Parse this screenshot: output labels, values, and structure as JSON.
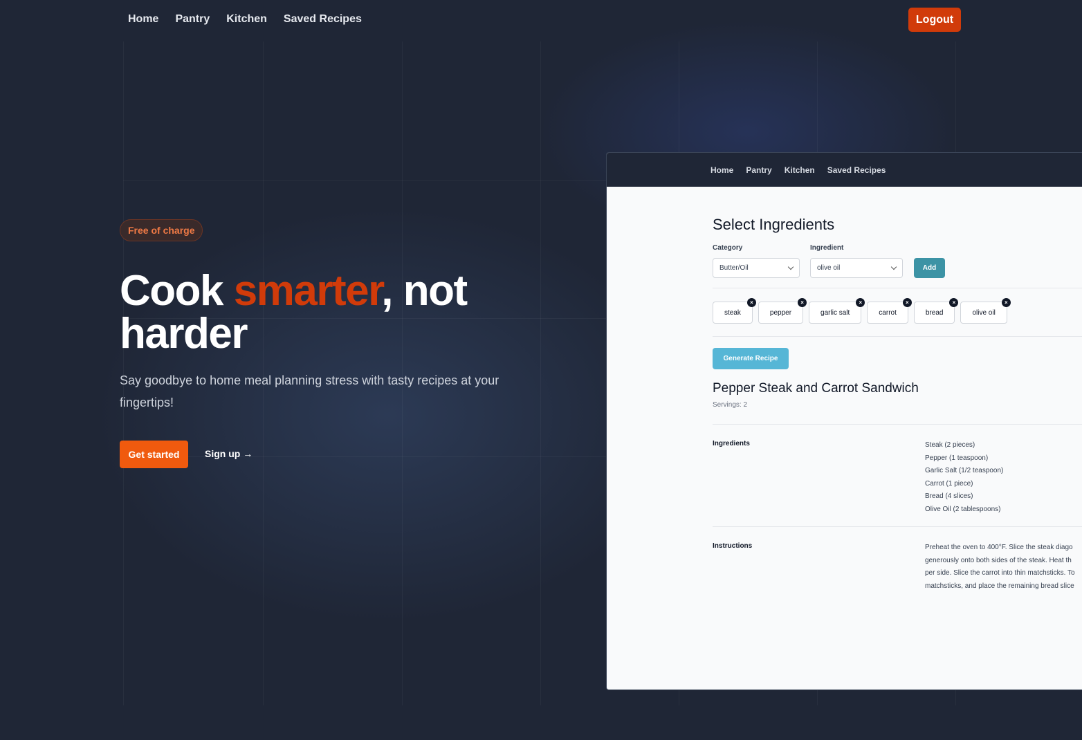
{
  "nav": {
    "links": [
      "Home",
      "Pantry",
      "Kitchen",
      "Saved Recipes"
    ],
    "logout_label": "Logout"
  },
  "hero": {
    "badge": "Free of charge",
    "headline_part1": "Cook ",
    "headline_accent": "smarter",
    "headline_part2": ", not harder",
    "subtext": "Say goodbye to home meal planning stress with tasty recipes at your fingertips!",
    "cta_label": "Get started",
    "signup_label": "Sign up →"
  },
  "preview": {
    "nav_links": [
      "Home",
      "Pantry",
      "Kitchen",
      "Saved Recipes"
    ],
    "title": "Select Ingredients",
    "category_label": "Category",
    "category_value": "Butter/Oil",
    "ingredient_label": "Ingredient",
    "ingredient_value": "olive oil",
    "add_label": "Add",
    "selected_ingredients": [
      "steak",
      "pepper",
      "garlic salt",
      "carrot",
      "bread",
      "olive oil"
    ],
    "remove_icon": "×",
    "generate_label": "Generate Recipe",
    "recipe_title": "Pepper Steak and Carrot Sandwich",
    "servings": "Servings: 2",
    "ingredients_label": "Ingredients",
    "ingredients": [
      "Steak (2 pieces)",
      "Pepper (1 teaspoon)",
      "Garlic Salt (1/2 teaspoon)",
      "Carrot (1 piece)",
      "Bread (4 slices)",
      "Olive Oil (2 tablespoons)"
    ],
    "instructions_label": "Instructions",
    "instructions_lines": [
      "Preheat the oven to 400°F. Slice the steak diago",
      "generously onto both sides of the steak. Heat th",
      "per side. Slice the carrot into thin matchsticks. To",
      "matchsticks, and place the remaining bread slice"
    ]
  },
  "colors": {
    "background": "#1f2636",
    "accent": "#d13b0a",
    "cta": "#f05a0e",
    "add_button": "#3c93a5",
    "generate_button": "#56b6d6"
  }
}
